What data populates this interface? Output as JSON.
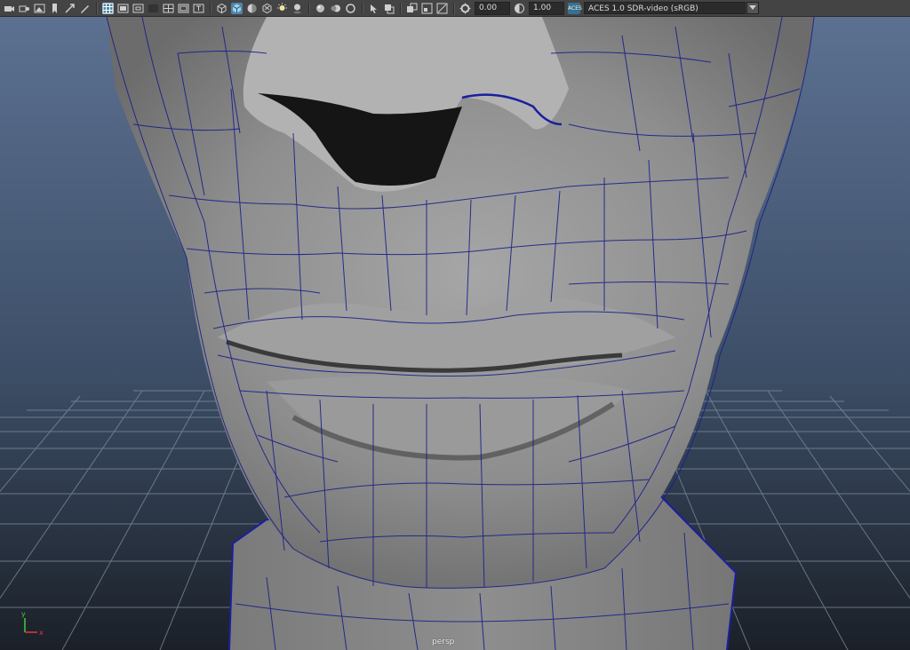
{
  "toolbar": {
    "exposure_value": "0.00",
    "gamma_value": "1.00",
    "color_space_badge": "ACES",
    "color_space_label": "ACES 1.0 SDR-video (sRGB)"
  },
  "viewport": {
    "camera_label": "persp",
    "axis_y": "y",
    "axis_x": "x"
  },
  "colors": {
    "bg_top": "#4e6180",
    "bg_bottom": "#1e242c",
    "grid": "#6f7e8e",
    "wireframe": "#1a1f8a",
    "model": "#9a9a9a",
    "toolbar": "#444444",
    "active_icon": "#5285a6"
  }
}
